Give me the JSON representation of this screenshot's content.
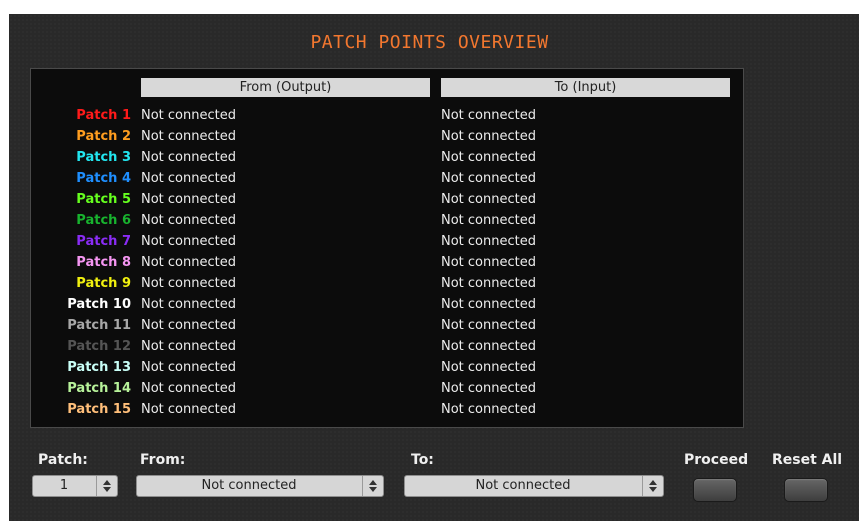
{
  "title": "PATCH POINTS OVERVIEW",
  "headers": {
    "from": "From (Output)",
    "to": "To (Input)"
  },
  "patches": [
    {
      "name": "Patch 1",
      "color": "#ff1a1a",
      "from": "Not connected",
      "to": "Not connected"
    },
    {
      "name": "Patch 2",
      "color": "#ff9d1f",
      "from": "Not connected",
      "to": "Not connected"
    },
    {
      "name": "Patch 3",
      "color": "#22e6f0",
      "from": "Not connected",
      "to": "Not connected"
    },
    {
      "name": "Patch 4",
      "color": "#1f8fff",
      "from": "Not connected",
      "to": "Not connected"
    },
    {
      "name": "Patch 5",
      "color": "#66ff1f",
      "from": "Not connected",
      "to": "Not connected"
    },
    {
      "name": "Patch 6",
      "color": "#18b32e",
      "from": "Not connected",
      "to": "Not connected"
    },
    {
      "name": "Patch 7",
      "color": "#8a2cf5",
      "from": "Not connected",
      "to": "Not connected"
    },
    {
      "name": "Patch 8",
      "color": "#f596f2",
      "from": "Not connected",
      "to": "Not connected"
    },
    {
      "name": "Patch 9",
      "color": "#f0f00f",
      "from": "Not connected",
      "to": "Not connected"
    },
    {
      "name": "Patch 10",
      "color": "#ffffff",
      "from": "Not connected",
      "to": "Not connected"
    },
    {
      "name": "Patch 11",
      "color": "#a8a8a8",
      "from": "Not connected",
      "to": "Not connected"
    },
    {
      "name": "Patch 12",
      "color": "#555555",
      "from": "Not connected",
      "to": "Not connected"
    },
    {
      "name": "Patch 13",
      "color": "#c9fff7",
      "from": "Not connected",
      "to": "Not connected"
    },
    {
      "name": "Patch 14",
      "color": "#b7f29a",
      "from": "Not connected",
      "to": "Not connected"
    },
    {
      "name": "Patch 15",
      "color": "#ffbf7a",
      "from": "Not connected",
      "to": "Not connected"
    }
  ],
  "controls": {
    "patch_label": "Patch:",
    "patch_value": "1",
    "from_label": "From:",
    "from_value": "Not connected",
    "to_label": "To:",
    "to_value": "Not connected",
    "proceed_label": "Proceed",
    "reset_label": "Reset All"
  }
}
